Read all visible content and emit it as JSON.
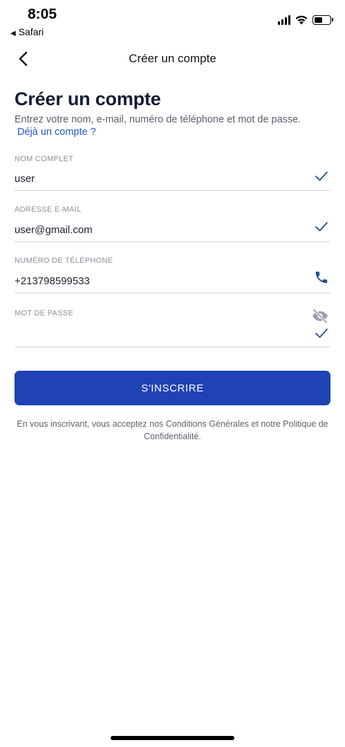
{
  "status_bar": {
    "time": "8:05",
    "back_app": "Safari"
  },
  "nav": {
    "title": "Créer un compte"
  },
  "page": {
    "title": "Créer un compte",
    "description": "Entrez votre nom, e-mail, numéro de téléphone et mot de passe.",
    "login_link": "Déjà un compte ?"
  },
  "fields": {
    "name": {
      "label": "NOM COMPLET",
      "value": "user",
      "icon": "check-icon"
    },
    "email": {
      "label": "ADRESSE E-MAIL",
      "value": "user@gmail.com",
      "icon": "check-icon"
    },
    "phone": {
      "label": "NUMÉRO DE TÉLÉPHONE",
      "value": "+213798599533",
      "icon": "phone-icon"
    },
    "password": {
      "label": "MOT DE PASSE",
      "value": "",
      "icon": "eye-off-icon"
    }
  },
  "submit": {
    "label": "S'INSCRIRE"
  },
  "terms": {
    "text": "En vous inscrivant, vous acceptez nos Conditions Générales et notre Politique de Confidentialité."
  },
  "colors": {
    "primary": "#1f43b5",
    "link": "#2456c7",
    "check": "#1f4f8a"
  }
}
